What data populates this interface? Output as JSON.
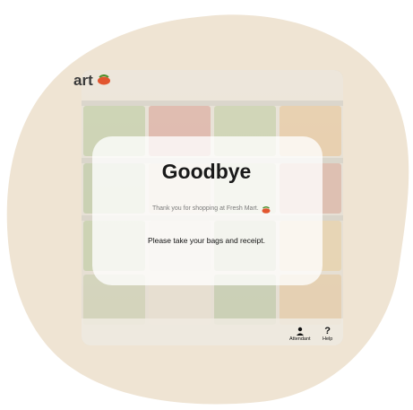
{
  "brand": {
    "name_fragment": "art"
  },
  "dialog": {
    "title": "Goodbye",
    "thanks": "Thank you for shopping at Fresh Mart.",
    "instruction": "Please take your bags and receipt."
  },
  "footer": {
    "attendant_label": "Attendant",
    "help_label": "Help",
    "help_glyph": "?"
  },
  "colors": {
    "blob": "#efe4d3",
    "card": "#ffffff",
    "title": "#1a1a1a"
  },
  "icons": [
    "tomato-logo-icon",
    "person-icon",
    "question-icon"
  ]
}
